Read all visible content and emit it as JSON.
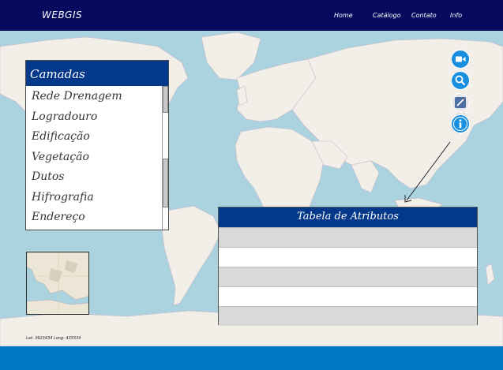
{
  "navbar": {
    "brand": "WEBGIS",
    "links": [
      "Home",
      "Catálogo",
      "Contato",
      "Info"
    ]
  },
  "layers": {
    "title": "Camadas",
    "items": [
      "Rede Drenagem",
      "Logradouro",
      "Edificação",
      "Vegetação",
      "Dutos",
      "Hifrografia",
      "Endereço"
    ]
  },
  "attributes": {
    "title": "Tabela de Atributos"
  },
  "coordinates": "Lat: 3923434 Long: 435534",
  "tools": [
    "video-camera-icon",
    "search-icon",
    "draw-icon",
    "info-icon"
  ],
  "colors": {
    "navbar": "#050a5e",
    "panel_header": "#04388a",
    "footer": "#0077c0",
    "ocean": "#aad3df",
    "land": "#f2efe9",
    "tool_button": "#1a8fe0"
  }
}
